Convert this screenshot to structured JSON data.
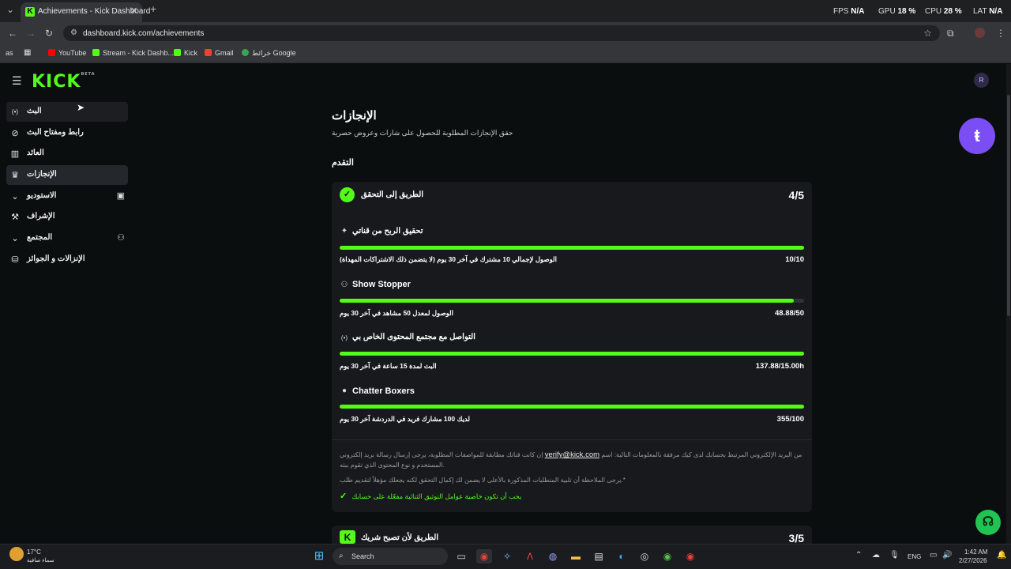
{
  "browser": {
    "tab_title": "Achievements - Kick Dashboard",
    "tab_close": "✕",
    "new_tab": "+",
    "tab_menu": "⌄",
    "perf": {
      "fps_label": "FPS",
      "fps_value": "N/A",
      "gpu_label": "GPU",
      "gpu_value": "18 %",
      "cpu_label": "CPU",
      "cpu_value": "28 %",
      "lat_label": "LAT",
      "lat_value": "N/A"
    },
    "url": "dashboard.kick.com/achievements",
    "bookmarks": [
      {
        "label": "YouTube",
        "color": "#ff0000"
      },
      {
        "label": "Stream - Kick Dashb...",
        "color": "#53fc18"
      },
      {
        "label": "Kick",
        "color": "#53fc18"
      },
      {
        "label": "Gmail",
        "color": "#ea4335"
      },
      {
        "label": "خرائط Google",
        "color": "#34a853"
      }
    ],
    "apps_label": "as"
  },
  "logo": {
    "text": "KICK",
    "beta": "BETA"
  },
  "avatar": {
    "initial": "R"
  },
  "sidebar": {
    "items": [
      {
        "label": "البث",
        "icon": "broadcast-icon",
        "glyph": "(•)"
      },
      {
        "label": "رابط ومفتاح البث",
        "icon": "link-icon",
        "glyph": "⊘"
      },
      {
        "label": "العائد",
        "icon": "chart-icon",
        "glyph": "▥"
      },
      {
        "label": "الإنجازات",
        "icon": "trophy-icon",
        "glyph": "🏆"
      },
      {
        "label": "الاستوديو",
        "icon": "chevron-down-icon",
        "glyph": "⌄"
      },
      {
        "label": "الإشراف",
        "icon": "wrench-icon",
        "glyph": "🔧"
      },
      {
        "label": "المجتمع",
        "icon": "chevron-down-icon",
        "glyph": "⌄"
      },
      {
        "label": "الإنزالات و الجوائز",
        "icon": "drops-icon",
        "glyph": "⛁"
      }
    ]
  },
  "main": {
    "title": "الإنجازات",
    "subtitle": "حقق الإنجازات المطلوبة للحصول على شارات وعروض حصرية",
    "progress_heading": "التقدم"
  },
  "card1": {
    "title": "الطريق إلى التحقق",
    "count": "4/5",
    "tasks": [
      {
        "title": "تحقيق الربح من قناتي",
        "icon": "sparkle-icon",
        "glyph": "✦",
        "desc": "الوصول لإجمالي 10 مشترك في آخر 30 يوم (لا يتضمن ذلك الاشتراكات المهداة)",
        "value": "10/10",
        "progress": 1.0
      },
      {
        "title": "Show Stopper",
        "icon": "people-icon",
        "glyph": "⚇",
        "desc": "الوصول لمعدل 50 مشاهد في آخر 30 يوم",
        "value": "48.88/50",
        "progress": 0.978
      },
      {
        "title": "التواصل مع مجتمع المحتوى الخاص بي",
        "icon": "broadcast-icon",
        "glyph": "(•)",
        "desc": "البث لمدة 15 ساعة في آخر 30 يوم",
        "value": "137.88/15.00h",
        "progress": 1.0
      },
      {
        "title": "Chatter Boxers",
        "icon": "chat-icon",
        "glyph": "●",
        "desc": "لديك 100 مشارك فريد في الدردشة آخر 30 يوم",
        "value": "355/100",
        "progress": 1.0
      }
    ],
    "note_part1": "إن كانت قناتك مطابقة للمواصفات المطلوبة، يرجى إرسال رسالة بريد إلكتروني",
    "note_email": "verify@kick.com",
    "note_part2": "من البريد الإلكتروني المرتبط بحسابك لدى كيك مرفقة بالمعلومات التالية: اسم المستخدم و نوع المحتوى الذي تقوم ببثه.",
    "note2": "يرجى الملاحظة أن تلبية المتطلبات المذكورة بالأعلى لا يضمن لك إكمال التحقق لكنه يجعلك مؤهلاً لتقديم طلب.*",
    "green_note": "يجب أن تكون خاصية عوامل التوثيق الثنائية مفعّلة على حسابك"
  },
  "card2": {
    "title": "الطريق لأن تصبح شريك",
    "count": "3/5"
  },
  "taskbar": {
    "weather_temp": "17°C",
    "weather_desc": "سماء صافية",
    "search_label": "Search",
    "lang": "ENG",
    "time": "1:42 AM",
    "date": "2/27/2026"
  }
}
